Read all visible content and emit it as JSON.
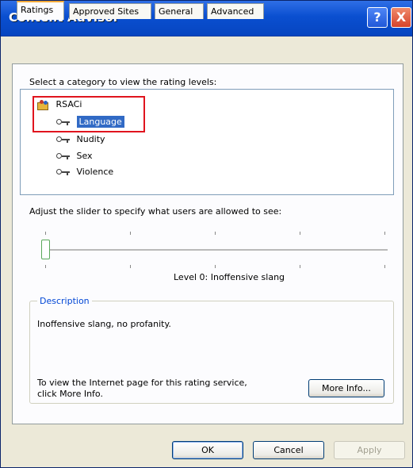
{
  "window": {
    "title": "Content Advisor"
  },
  "titlebar_buttons": {
    "help": "?",
    "close": "X"
  },
  "tabs": [
    {
      "label": "Ratings"
    },
    {
      "label": "Approved Sites"
    },
    {
      "label": "General"
    },
    {
      "label": "Advanced"
    }
  ],
  "ratings": {
    "category_prompt": "Select a category to view the rating levels:",
    "root": "RSACi",
    "categories": [
      "Language",
      "Nudity",
      "Sex",
      "Violence"
    ],
    "selected_category": "Language",
    "slider_prompt": "Adjust the slider to specify what users are allowed to see:",
    "level_value": 0,
    "level_text": "Level 0:  Inoffensive slang",
    "description_title": "Description",
    "description_text": "Inoffensive slang, no profanity.",
    "more_info_text_line1": "To view the Internet page for this rating service,",
    "more_info_text_line2": "click More Info.",
    "more_info_button": "More Info..."
  },
  "footer": {
    "ok": "OK",
    "cancel": "Cancel",
    "apply": "Apply"
  },
  "colors": {
    "titlebar": "#0a4fd0",
    "selection": "#316ac5",
    "highlight_box": "#e0141e",
    "dialog_bg": "#ece9d8"
  },
  "icons": {
    "root": "ratings-folder-icon",
    "category": "key-icon"
  }
}
